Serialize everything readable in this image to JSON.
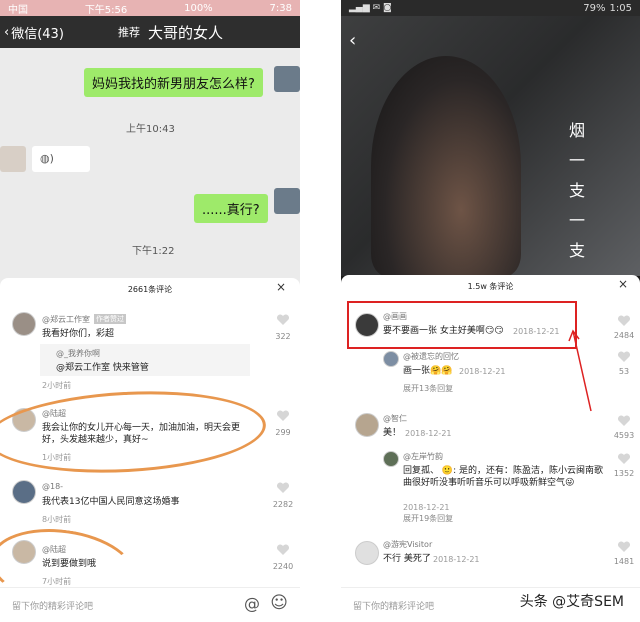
{
  "left": {
    "status": {
      "carrier": "中国",
      "time": "下午5:56",
      "right": "100%",
      "time_right": "7:38"
    },
    "wechat": {
      "back": "微信(43)",
      "title": "大哥的女人",
      "tab": "推荐"
    },
    "chat": {
      "msg1": "妈妈我找的新男朋友怎么样?",
      "time1": "上午10:43",
      "msg2": "......真行?",
      "time2": "下午1:22"
    },
    "comments": {
      "header": "2661条评论",
      "close": "×",
      "items": [
        {
          "name": "@郑云工作室",
          "tag": "作者赞过",
          "text": "我看好你们，彩超",
          "reply_name": "@_我养你啊",
          "reply_text": "@郑云工作室 快来管管",
          "time": "2小时前",
          "likes": "322"
        },
        {
          "name": "@陆超",
          "text": "我会让你的女儿开心每一天，加油加油，明天会更好，头发越来越少，真好~",
          "time": "1小时前",
          "likes": "299"
        },
        {
          "name": "@18-",
          "text": "我代表13亿中国人民同意这场婚事",
          "time": "8小时前",
          "likes": "2282"
        },
        {
          "name": "@陆超",
          "text": "说到要做到哦",
          "time": "7小时前",
          "likes": "2240"
        }
      ],
      "reply_placeholder": "留下你的精彩评论吧",
      "at_icon": "@",
      "emoji_icon": "☺"
    }
  },
  "right": {
    "status": {
      "time": "1:05",
      "battery": "79%"
    },
    "poster_text": [
      "烟",
      "一",
      "支",
      "一",
      "支"
    ],
    "comments": {
      "header": "1.5w 条评论",
      "close": "×",
      "items": [
        {
          "name": "@画画",
          "text": "要不要画一张 女主好美啊😏😏",
          "time": "2018-12-21",
          "likes": "2484"
        },
        {
          "name": "@被遗忘的回忆",
          "text": "画一张🤗🤗",
          "time": "2018-12-21",
          "likes": "53",
          "more": "展开13条回复"
        },
        {
          "name": "@智仁",
          "text": "美！",
          "time": "2018-12-21",
          "likes": "4593"
        },
        {
          "name": "@左岸竹韵",
          "text": "回复孤、 🙂: 是的，还有：陈盈洁，陈小云闽南歌曲很好听没事听听音乐可以呼吸新鲜空气😜",
          "time": "2018-12-21",
          "likes": "1352",
          "more": "展开19条回复"
        },
        {
          "name": "@游宪Visitor",
          "text": "不行 美死了",
          "time": "2018-12-21",
          "likes": "1481"
        }
      ],
      "reply_placeholder": "留下你的精彩评论吧"
    },
    "watermark": "头条 @艾奇SEM"
  }
}
